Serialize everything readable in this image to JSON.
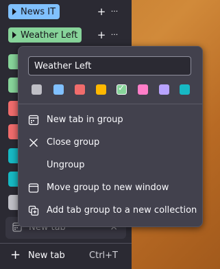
{
  "colors": {
    "sidebar_bg": "#2b2a33",
    "menu_bg": "#42414d",
    "text": "#fbfbfe",
    "blue": "#80c0ff",
    "green": "#87d49a",
    "red": "#f06c6c",
    "teal": "#17b9c4",
    "grey": "#bfbfc6"
  },
  "sidebar": {
    "groups": [
      {
        "label": "News IT",
        "color": "#80c0ff",
        "add_action": "+",
        "more_action": "···"
      },
      {
        "label": "Weather Left",
        "color": "#87d49a",
        "add_action": "+",
        "more_action": "···"
      }
    ],
    "collapsed_groups": [
      {
        "color": "#87d49a"
      },
      {
        "color": "#87d49a"
      },
      {
        "color": "#f06c6c"
      },
      {
        "color": "#f06c6c"
      },
      {
        "color": "#17b9c4"
      },
      {
        "color": "#17b9c4"
      },
      {
        "color": "#bfbfc6"
      }
    ],
    "dragging_tab": {
      "label": "New tab",
      "close": "×"
    },
    "new_tab": {
      "label": "New tab",
      "shortcut": "Ctrl+T",
      "icon": "plus-icon"
    }
  },
  "menu": {
    "group_name_value": "Weather Left",
    "swatches": [
      {
        "name": "grey",
        "color": "#bfbfc6",
        "selected": false
      },
      {
        "name": "blue",
        "color": "#80c0ff",
        "selected": false
      },
      {
        "name": "red",
        "color": "#f06c6c",
        "selected": false
      },
      {
        "name": "yellow",
        "color": "#ffb800",
        "selected": false
      },
      {
        "name": "green",
        "color": "#87d49a",
        "selected": true
      },
      {
        "name": "pink",
        "color": "#ff7ec8",
        "selected": false
      },
      {
        "name": "purple",
        "color": "#b8a3ff",
        "selected": false
      },
      {
        "name": "cyan",
        "color": "#17b9c4",
        "selected": false
      }
    ],
    "items": [
      {
        "label": "New tab in group",
        "icon": "new-tab-in-group-icon"
      },
      {
        "label": "Close group",
        "icon": "close-icon"
      },
      {
        "label": "Ungroup",
        "icon": ""
      },
      {
        "label": "Move group to new window",
        "icon": "window-icon"
      },
      {
        "label": "Add tab group to a new collection",
        "icon": "collection-icon"
      }
    ]
  }
}
